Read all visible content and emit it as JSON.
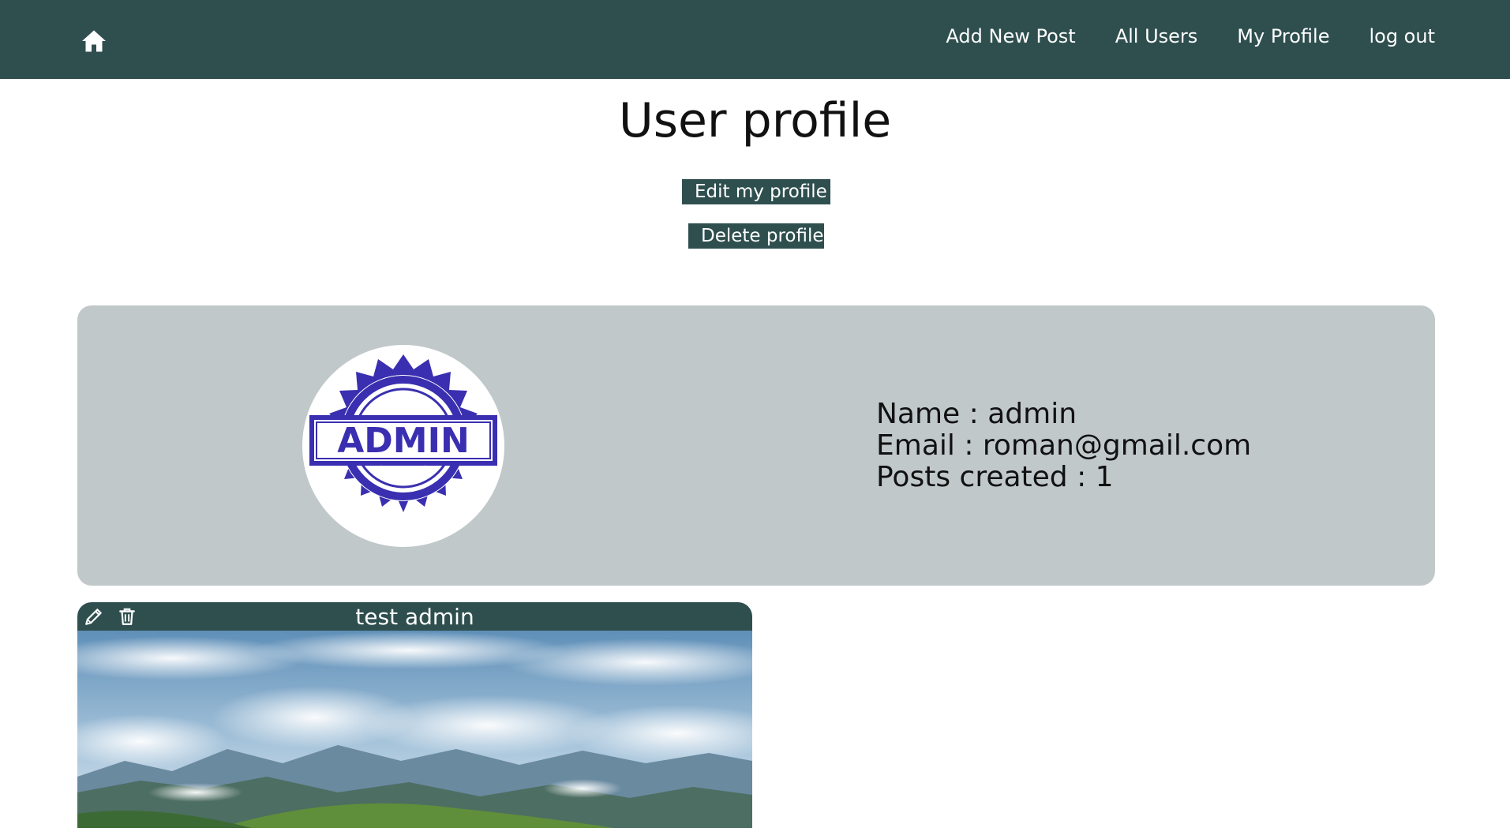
{
  "nav": {
    "home_icon": "home-icon",
    "links": [
      "Add New Post",
      "All Users",
      "My Profile",
      "log out"
    ]
  },
  "page": {
    "title": "User profile"
  },
  "actions": {
    "edit_label": "Edit my profile",
    "delete_label": "Delete profile"
  },
  "profile": {
    "avatar_badge_text": "ADMIN",
    "name_line": "Name : admin",
    "email_line": "Email : roman@gmail.com",
    "posts_line": "Posts created : 1"
  },
  "post": {
    "title": "test admin",
    "edit_icon": "pencil-icon",
    "delete_icon": "trash-icon"
  },
  "colors": {
    "primary": "#2f4f4f",
    "card_bg": "#c0c8ca",
    "text_on_primary": "#ffffff"
  }
}
